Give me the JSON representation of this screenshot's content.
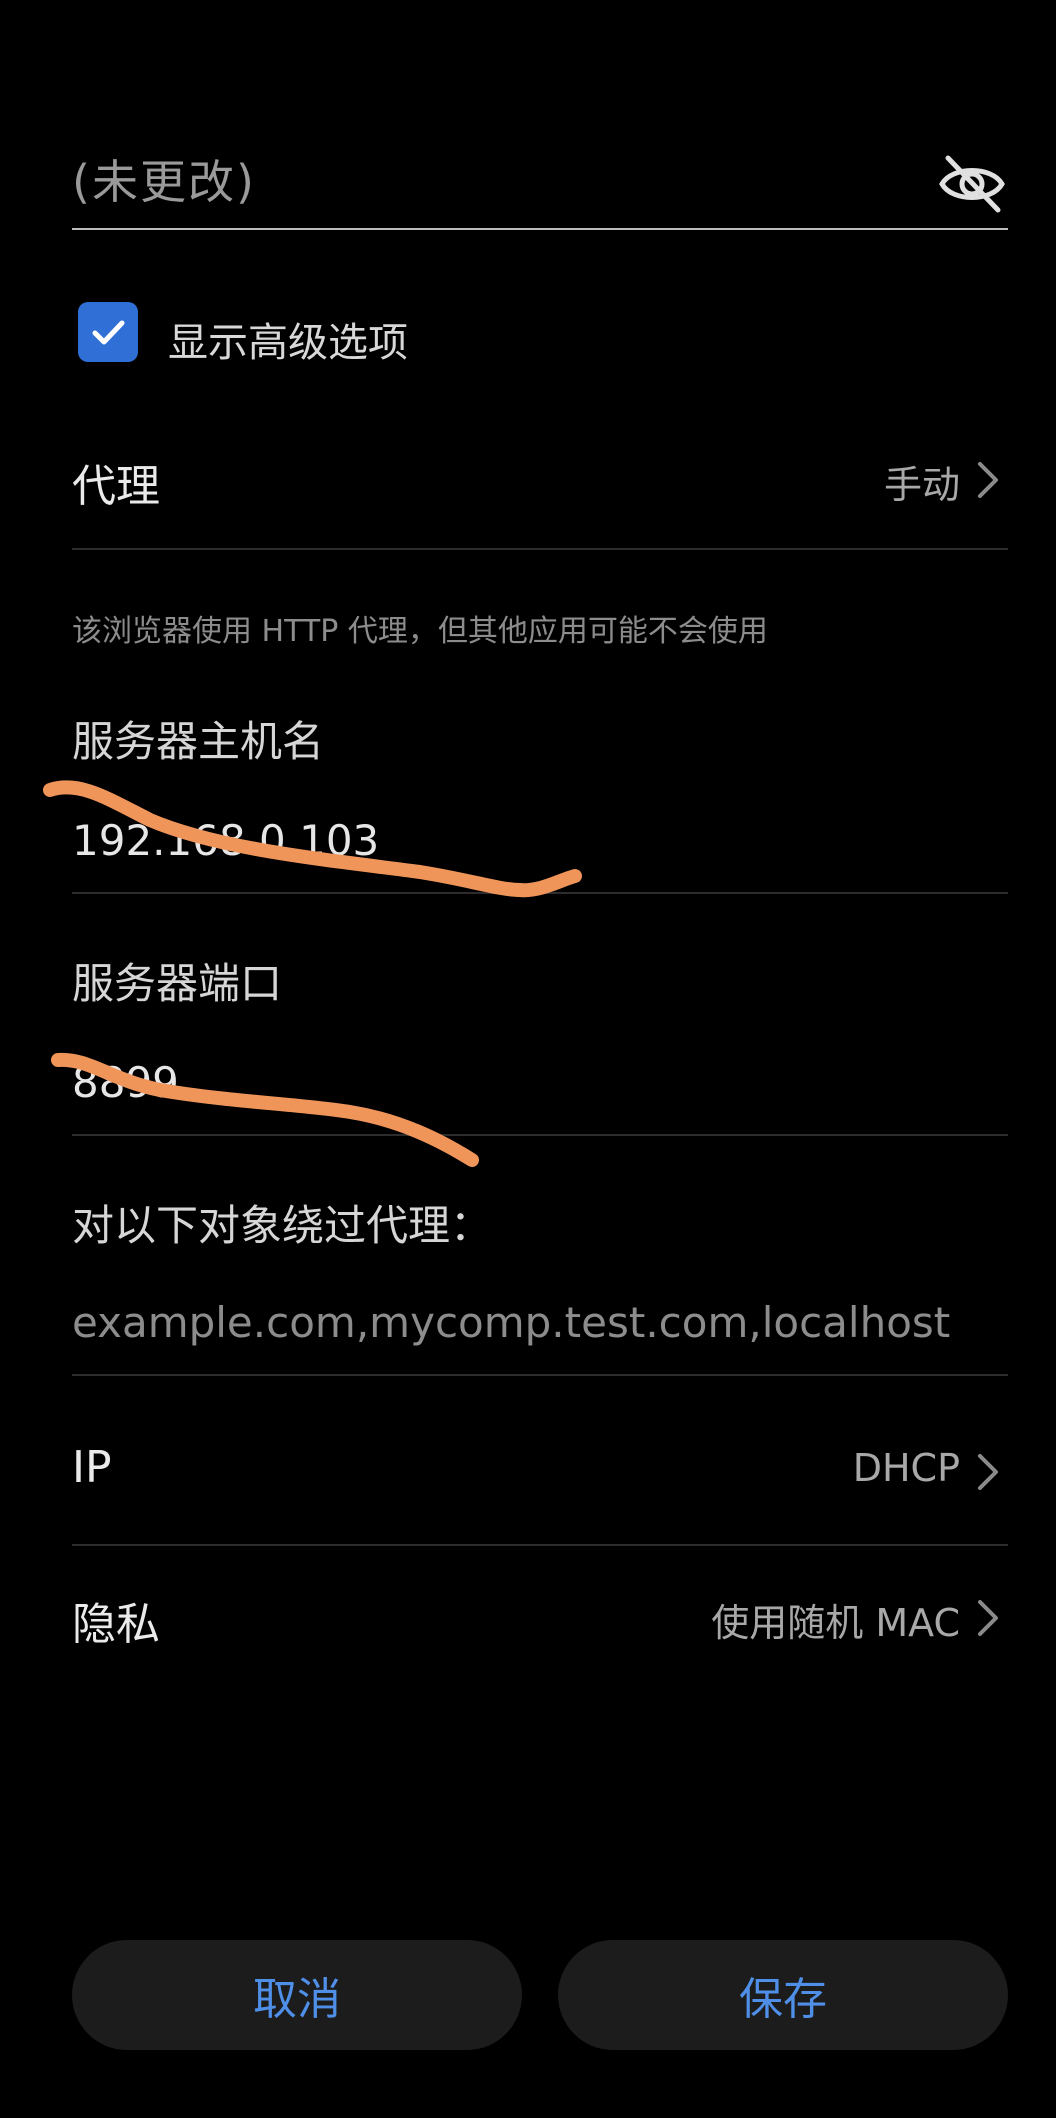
{
  "password": {
    "placeholder": "(未更改)",
    "visibility_icon": "eye-slash-icon"
  },
  "advanced": {
    "checked": true,
    "label": "显示高级选项"
  },
  "proxy": {
    "title": "代理",
    "value": "手动",
    "hint": "该浏览器使用 HTTP 代理，但其他应用可能不会使用"
  },
  "server_host": {
    "label": "服务器主机名",
    "value": "192.168.0.103"
  },
  "server_port": {
    "label": "服务器端口",
    "value": "8899"
  },
  "bypass": {
    "label": "对以下对象绕过代理：",
    "placeholder": "example.com,mycomp.test.com,localhost"
  },
  "ip": {
    "title": "IP",
    "value": "DHCP"
  },
  "privacy": {
    "title": "隐私",
    "value": "使用随机 MAC"
  },
  "buttons": {
    "cancel": "取消",
    "save": "保存"
  },
  "colors": {
    "accent": "#4f8fe8",
    "checkbox": "#2f6fd6",
    "annotation": "#f0955a",
    "background": "#000000"
  }
}
